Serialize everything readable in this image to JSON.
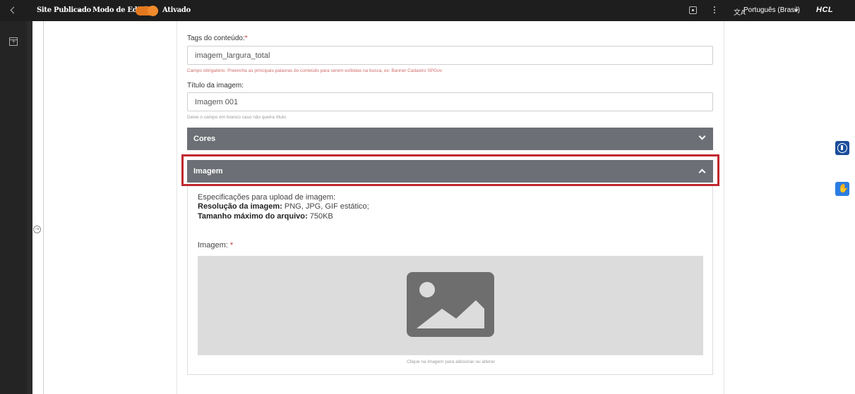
{
  "topbar": {
    "site_label": "Site Publicado",
    "edit_mode_label": "Modo de Edição:",
    "edit_mode_state": "Ativado",
    "language": "Português (Brasil)",
    "language_icon_glyph": "文A",
    "logo": "HCL",
    "accent_color": "#e3781e"
  },
  "form": {
    "tags": {
      "label": "Tags do conteúdo:",
      "required_mark": "*",
      "value": "imagem_largura_total",
      "help": "Campo obrigatório. Preencha as principais palavras do conteúdo para serem exibidas na busca, ex: Banner Cadastro SPGov"
    },
    "title": {
      "label": "Título da imagem:",
      "value": "Imagem 001",
      "help": "Deixe o campo em branco caso não queira título."
    },
    "sections": [
      {
        "label": "Cores",
        "state": "collapsed",
        "icon": "chevron-down-icon"
      },
      {
        "label": "Imagem",
        "state": "expanded",
        "icon": "chevron-up-icon"
      }
    ],
    "image_panel": {
      "spec_intro": "Especificações para upload de imagem:",
      "resolution_label": "Resolução da imagem:",
      "resolution_value": " PNG, JPG, GIF estático;",
      "size_label": "Tamanho máximo do arquivo:",
      "size_value": " 750KB",
      "field_label": "Imagem:",
      "required_mark": "*",
      "upload_hint": "Clique na imagem para adicionar ou alterar",
      "placeholder_icon": "image-placeholder-icon"
    }
  },
  "floating": {
    "accessibility_icon": "accessibility-icon",
    "sign_language_icon": "sign-language-icon"
  }
}
